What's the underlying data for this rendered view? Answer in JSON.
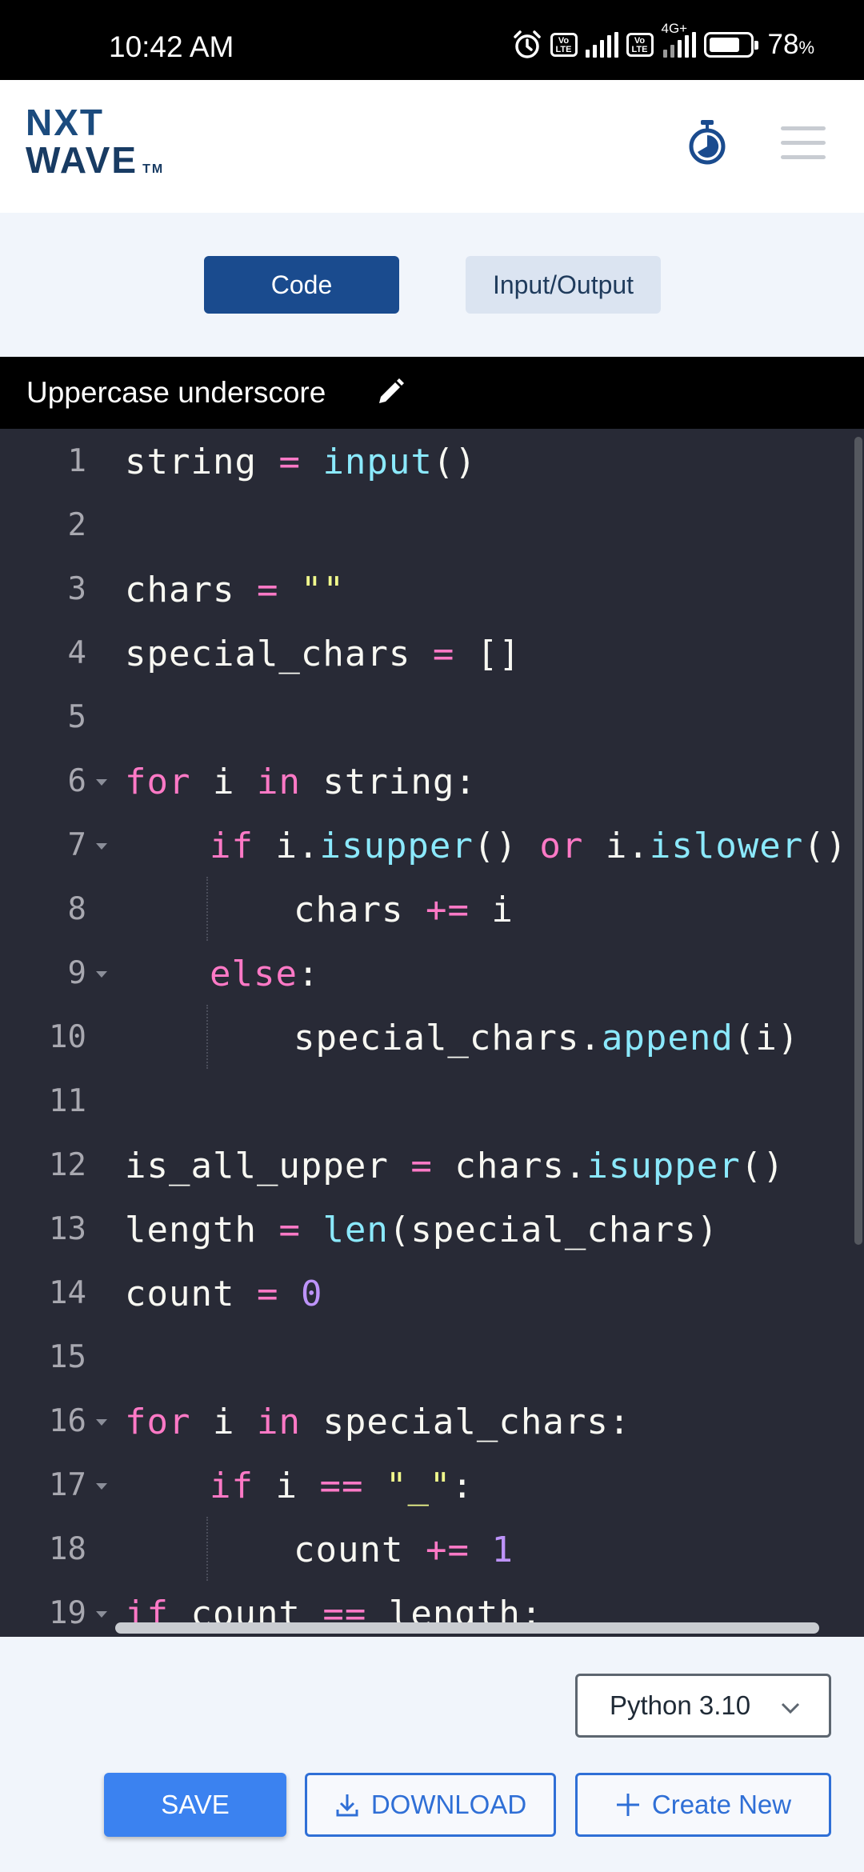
{
  "status_bar": {
    "time": "10:42 AM",
    "network": "4G+",
    "battery_percent": "78",
    "battery_unit": "%",
    "volte_label": "Vo LTE"
  },
  "header": {
    "logo_line1": "NXT",
    "logo_line2": "WAVE",
    "logo_tm": "TM"
  },
  "tabs": {
    "code": "Code",
    "io": "Input/Output",
    "active": "code"
  },
  "file": {
    "title": "Uppercase underscore"
  },
  "editor": {
    "line_numbers": [
      "1",
      "2",
      "3",
      "4",
      "5",
      "6",
      "7",
      "8",
      "9",
      "10",
      "11",
      "12",
      "13",
      "14",
      "15",
      "16",
      "17",
      "18",
      "19"
    ],
    "lines": [
      "string = input()",
      "",
      "chars = \"\"",
      "special_chars = []",
      "",
      "for i in string:",
      "    if i.isupper() or i.islower():",
      "        chars += i",
      "    else:",
      "        special_chars.append(i)",
      "",
      "is_all_upper = chars.isupper()",
      "length = len(special_chars)",
      "count = 0",
      "",
      "for i in special_chars:",
      "    if i == \"_\":",
      "        count += 1",
      "if count == length:"
    ],
    "colors": {
      "background": "#282a36",
      "keyword": "#ff79c6",
      "function": "#8be9fd",
      "string": "#f1fa8c",
      "number": "#bd93f9"
    }
  },
  "footer": {
    "language": "Python 3.10",
    "save_label": "SAVE",
    "download_label": "DOWNLOAD",
    "create_new_label": "Create New"
  }
}
